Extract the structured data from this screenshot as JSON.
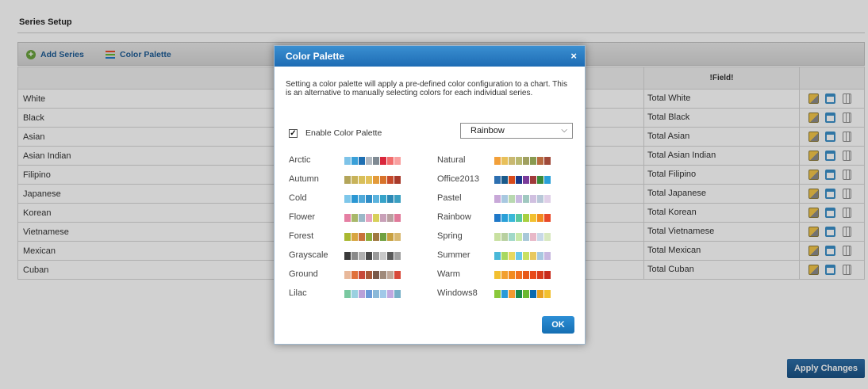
{
  "section": {
    "title": "Series Setup"
  },
  "toolbar": {
    "add_series": "Add Series",
    "color_palette": "Color Palette"
  },
  "grid": {
    "field_header": "!Field!",
    "rows": [
      {
        "name": "White",
        "total": "Total White"
      },
      {
        "name": "Black",
        "total": "Total Black"
      },
      {
        "name": "Asian",
        "total": "Total Asian"
      },
      {
        "name": "Asian Indian",
        "total": "Total Asian Indian"
      },
      {
        "name": "Filipino",
        "total": "Total Filipino"
      },
      {
        "name": "Japanese",
        "total": "Total Japanese"
      },
      {
        "name": "Korean",
        "total": "Total Korean"
      },
      {
        "name": "Vietnamese",
        "total": "Total Vietnamese"
      },
      {
        "name": "Mexican",
        "total": "Total Mexican"
      },
      {
        "name": "Cuban",
        "total": "Total Cuban"
      }
    ],
    "row_action_icons": [
      "edit-icon",
      "copy-icon",
      "delete-icon"
    ]
  },
  "apply_button": "Apply Changes",
  "modal": {
    "title": "Color Palette",
    "close": "×",
    "description": "Setting a color palette will apply a pre-defined color configuration to a chart. This is an alternative to manually selecting colors for each individual series.",
    "enable_label": "Enable Color Palette",
    "enabled": true,
    "checkmark": "✓",
    "selected_palette": "Rainbow",
    "ok": "OK",
    "palettes_left": [
      {
        "name": "Arctic",
        "colors": [
          "#7ec3e8",
          "#3aa0d8",
          "#1f6fb2",
          "#b0b7bf",
          "#7f8a93",
          "#d9273c",
          "#f26d6d",
          "#f9a0a0"
        ]
      },
      {
        "name": "Autumn",
        "colors": [
          "#b3a55a",
          "#c8b35a",
          "#d8bf5a",
          "#e2c15a",
          "#e39a3a",
          "#d8732b",
          "#c64a2b",
          "#a83a2b"
        ]
      },
      {
        "name": "Cold",
        "colors": [
          "#7ec7ea",
          "#2b97d3",
          "#4fa9d9",
          "#2f8dc7",
          "#5bb3dd",
          "#37a3c9",
          "#2c89b6",
          "#3b9fc1"
        ]
      },
      {
        "name": "Flower",
        "colors": [
          "#e57fa3",
          "#a8b86a",
          "#9ab8c8",
          "#e4a3c1",
          "#d8d05a",
          "#c8a0b8",
          "#b8a0a0",
          "#e07a9a"
        ]
      },
      {
        "name": "Forest",
        "colors": [
          "#a9b830",
          "#d8a540",
          "#c8713a",
          "#8cab3a",
          "#a07840",
          "#6fa040",
          "#c8a040",
          "#d8b870"
        ]
      },
      {
        "name": "Grayscale",
        "colors": [
          "#3a3a3a",
          "#8a8a8a",
          "#b0b0b0",
          "#4a4a4a",
          "#9a9a9a",
          "#c8c8c8",
          "#5a5a5a",
          "#a0a0a0"
        ]
      },
      {
        "name": "Ground",
        "colors": [
          "#e8b89a",
          "#e0703a",
          "#c84a3a",
          "#a85a3a",
          "#7a5a4a",
          "#a08a7a",
          "#c0a898",
          "#d84a3a"
        ]
      },
      {
        "name": "Lilac",
        "colors": [
          "#7ac8a0",
          "#9ad0e0",
          "#b8a0d8",
          "#6a9ad8",
          "#8ab8d8",
          "#a0c8e8",
          "#c0a8e0",
          "#78b0c8"
        ]
      }
    ],
    "palettes_right": [
      {
        "name": "Natural",
        "colors": [
          "#f2a03a",
          "#e8c05a",
          "#c8b870",
          "#b8b870",
          "#a0a060",
          "#8a9a50",
          "#b86a40",
          "#a04a3a"
        ]
      },
      {
        "name": "Office2013",
        "colors": [
          "#2d6fb0",
          "#1a5a8a",
          "#d84a1a",
          "#1a3a8a",
          "#7a3a9a",
          "#a03a3a",
          "#3a8a3a",
          "#2aa0d8"
        ]
      },
      {
        "name": "Pastel",
        "colors": [
          "#c8a8d8",
          "#a8c8e0",
          "#b8d8b0",
          "#c8b8e0",
          "#a0c8c0",
          "#d0c0e0",
          "#b8c8d8",
          "#e0d0e8"
        ]
      },
      {
        "name": "Rainbow",
        "colors": [
          "#1f78c8",
          "#2aa0d8",
          "#3ab8d8",
          "#5ac8a0",
          "#a8d040",
          "#f2c030",
          "#f28a20",
          "#e84a2a"
        ]
      },
      {
        "name": "Spring",
        "colors": [
          "#c8e0a0",
          "#b8d0a0",
          "#a0d8c8",
          "#c8e8a8",
          "#a8c8d8",
          "#e8b8c8",
          "#c8d8e8",
          "#d8e8c0"
        ]
      },
      {
        "name": "Summer",
        "colors": [
          "#4ab8d8",
          "#a8d860",
          "#e8d860",
          "#6ac8e8",
          "#c8e060",
          "#e8c860",
          "#a8c8e0",
          "#c8b8e0"
        ]
      },
      {
        "name": "Warm",
        "colors": [
          "#f2c030",
          "#f2a030",
          "#f28a20",
          "#f07020",
          "#e85a1a",
          "#e84a1a",
          "#d83a1a",
          "#c82a1a"
        ]
      },
      {
        "name": "Windows8",
        "colors": [
          "#8ac83a",
          "#2a9ad8",
          "#f29a30",
          "#1a8a4a",
          "#6ab830",
          "#0a6ab0",
          "#e8a020",
          "#f2c030"
        ]
      }
    ]
  },
  "colors": {
    "toolbar_link": "#1d5b94",
    "modal_header": "#1e6cb4",
    "apply_button": "#1a5285",
    "ok_button": "#156fb3"
  },
  "icons": {
    "add": "plus-circle-icon",
    "palette": "color-palette-icon",
    "close": "close-icon",
    "checkbox": "checkbox-icon",
    "dropdown": "chevron-down-icon"
  }
}
